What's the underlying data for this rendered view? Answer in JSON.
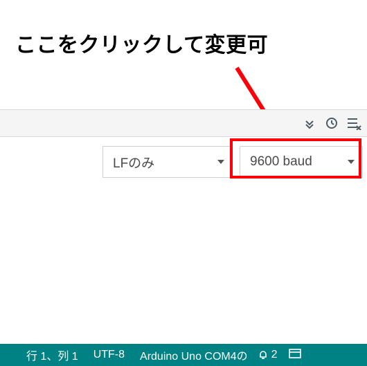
{
  "annotation": {
    "text": "ここをクリックして変更可"
  },
  "toolbar_icons": {
    "autoscroll": "autoscroll",
    "timestamp": "timestamp",
    "clear": "clear"
  },
  "dropdowns": {
    "line_ending": {
      "value": "LFのみ"
    },
    "baud_rate": {
      "value": "9600 baud"
    }
  },
  "statusbar": {
    "cursor": "行 1、列 1",
    "encoding": "UTF-8",
    "board": "Arduino Uno COM4の",
    "notifications": "2"
  }
}
